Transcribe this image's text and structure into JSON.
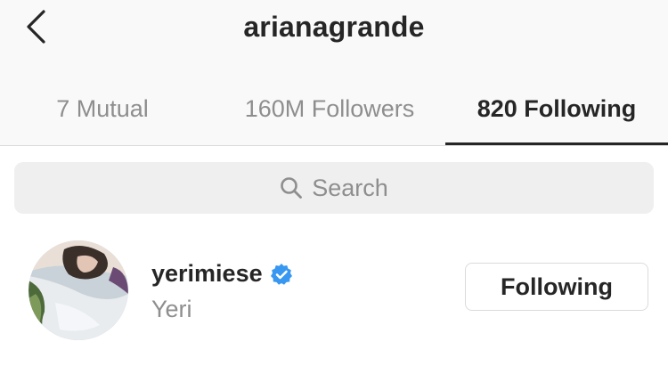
{
  "header": {
    "title": "arianagrande",
    "back_icon": "chevron-left-icon"
  },
  "tabs": [
    {
      "label": "7 Mutual",
      "active": false
    },
    {
      "label": "160M Followers",
      "active": false
    },
    {
      "label": "820 Following",
      "active": true
    }
  ],
  "search": {
    "placeholder": "Search",
    "icon": "search-icon"
  },
  "list": [
    {
      "username": "yerimiese",
      "verified": true,
      "full_name": "Yeri",
      "button_label": "Following"
    }
  ],
  "colors": {
    "verified_badge": "#3897f0",
    "text_primary": "#262626",
    "text_secondary": "#8e8e8e",
    "divider": "#dbdbdb"
  }
}
